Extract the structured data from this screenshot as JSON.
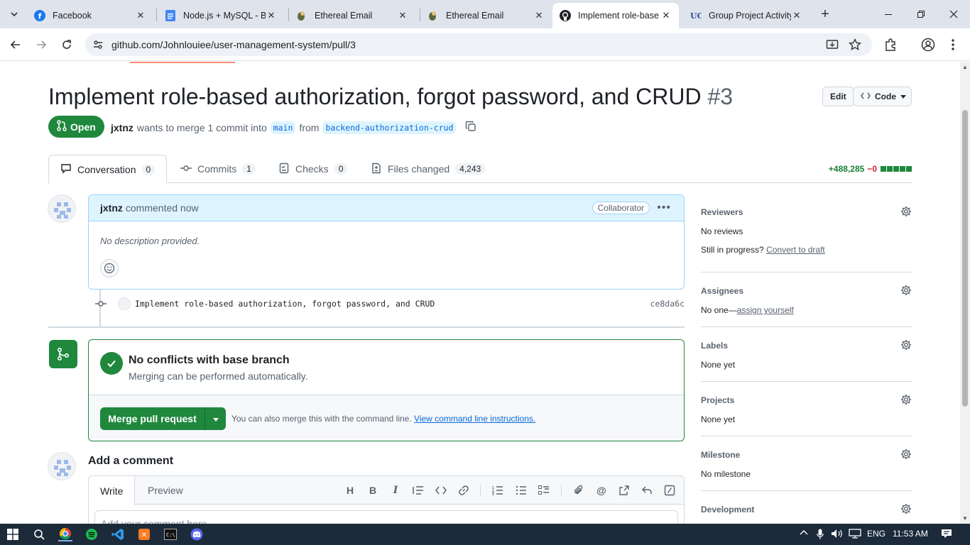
{
  "browser": {
    "tabs": [
      {
        "title": "Facebook",
        "icon": "facebook-icon"
      },
      {
        "title": "Node.js + MySQL - Bo",
        "icon": "docs-icon"
      },
      {
        "title": "Ethereal Email",
        "icon": "ethereal-icon"
      },
      {
        "title": "Ethereal Email",
        "icon": "ethereal-icon"
      },
      {
        "title": "Implement role-base",
        "icon": "github-icon"
      },
      {
        "title": "Group Project Activity",
        "icon": "uc-icon"
      }
    ],
    "url": "github.com/Johnlouiee/user-management-system/pull/3"
  },
  "pr": {
    "title": "Implement role-based authorization, forgot password, and CRUD",
    "number": "#3",
    "edit_label": "Edit",
    "code_label": "Code",
    "state": "Open",
    "author": "jxtnz",
    "merge_text": "wants to merge 1 commit into",
    "base_branch": "main",
    "from_text": "from",
    "head_branch": "backend-authorization-crud",
    "tabs": [
      {
        "label": "Conversation",
        "count": "0"
      },
      {
        "label": "Commits",
        "count": "1"
      },
      {
        "label": "Checks",
        "count": "0"
      },
      {
        "label": "Files changed",
        "count": "4,243"
      }
    ],
    "additions": "+488,285",
    "deletions": "−0"
  },
  "comment": {
    "author": "jxtnz",
    "action": "commented now",
    "role": "Collaborator",
    "body": "No description provided."
  },
  "commit": {
    "message": "Implement role-based authorization, forgot password, and CRUD",
    "sha": "ce8da6c"
  },
  "merge": {
    "title": "No conflicts with base branch",
    "subtitle": "Merging can be performed automatically.",
    "button": "Merge pull request",
    "hint": "You can also merge this with the command line.",
    "hint_link": "View command line instructions."
  },
  "add_comment": {
    "title": "Add a comment",
    "write_tab": "Write",
    "preview_tab": "Preview",
    "placeholder": "Add your comment here..."
  },
  "sidebar": {
    "reviewers": {
      "title": "Reviewers",
      "value": "No reviews",
      "progress_text": "Still in progress?",
      "progress_link": "Convert to draft"
    },
    "assignees": {
      "title": "Assignees",
      "value": "No one—",
      "link": "assign yourself"
    },
    "labels": {
      "title": "Labels",
      "value": "None yet"
    },
    "projects": {
      "title": "Projects",
      "value": "None yet"
    },
    "milestone": {
      "title": "Milestone",
      "value": "No milestone"
    },
    "development": {
      "title": "Development"
    }
  },
  "taskbar": {
    "lang": "ENG",
    "time": "11:53 AM"
  },
  "colors": {
    "accent_green": "#1f883d",
    "link_blue": "#0969da",
    "tab_strip": "#dfe3eb",
    "taskbar": "#1c2a3a"
  }
}
